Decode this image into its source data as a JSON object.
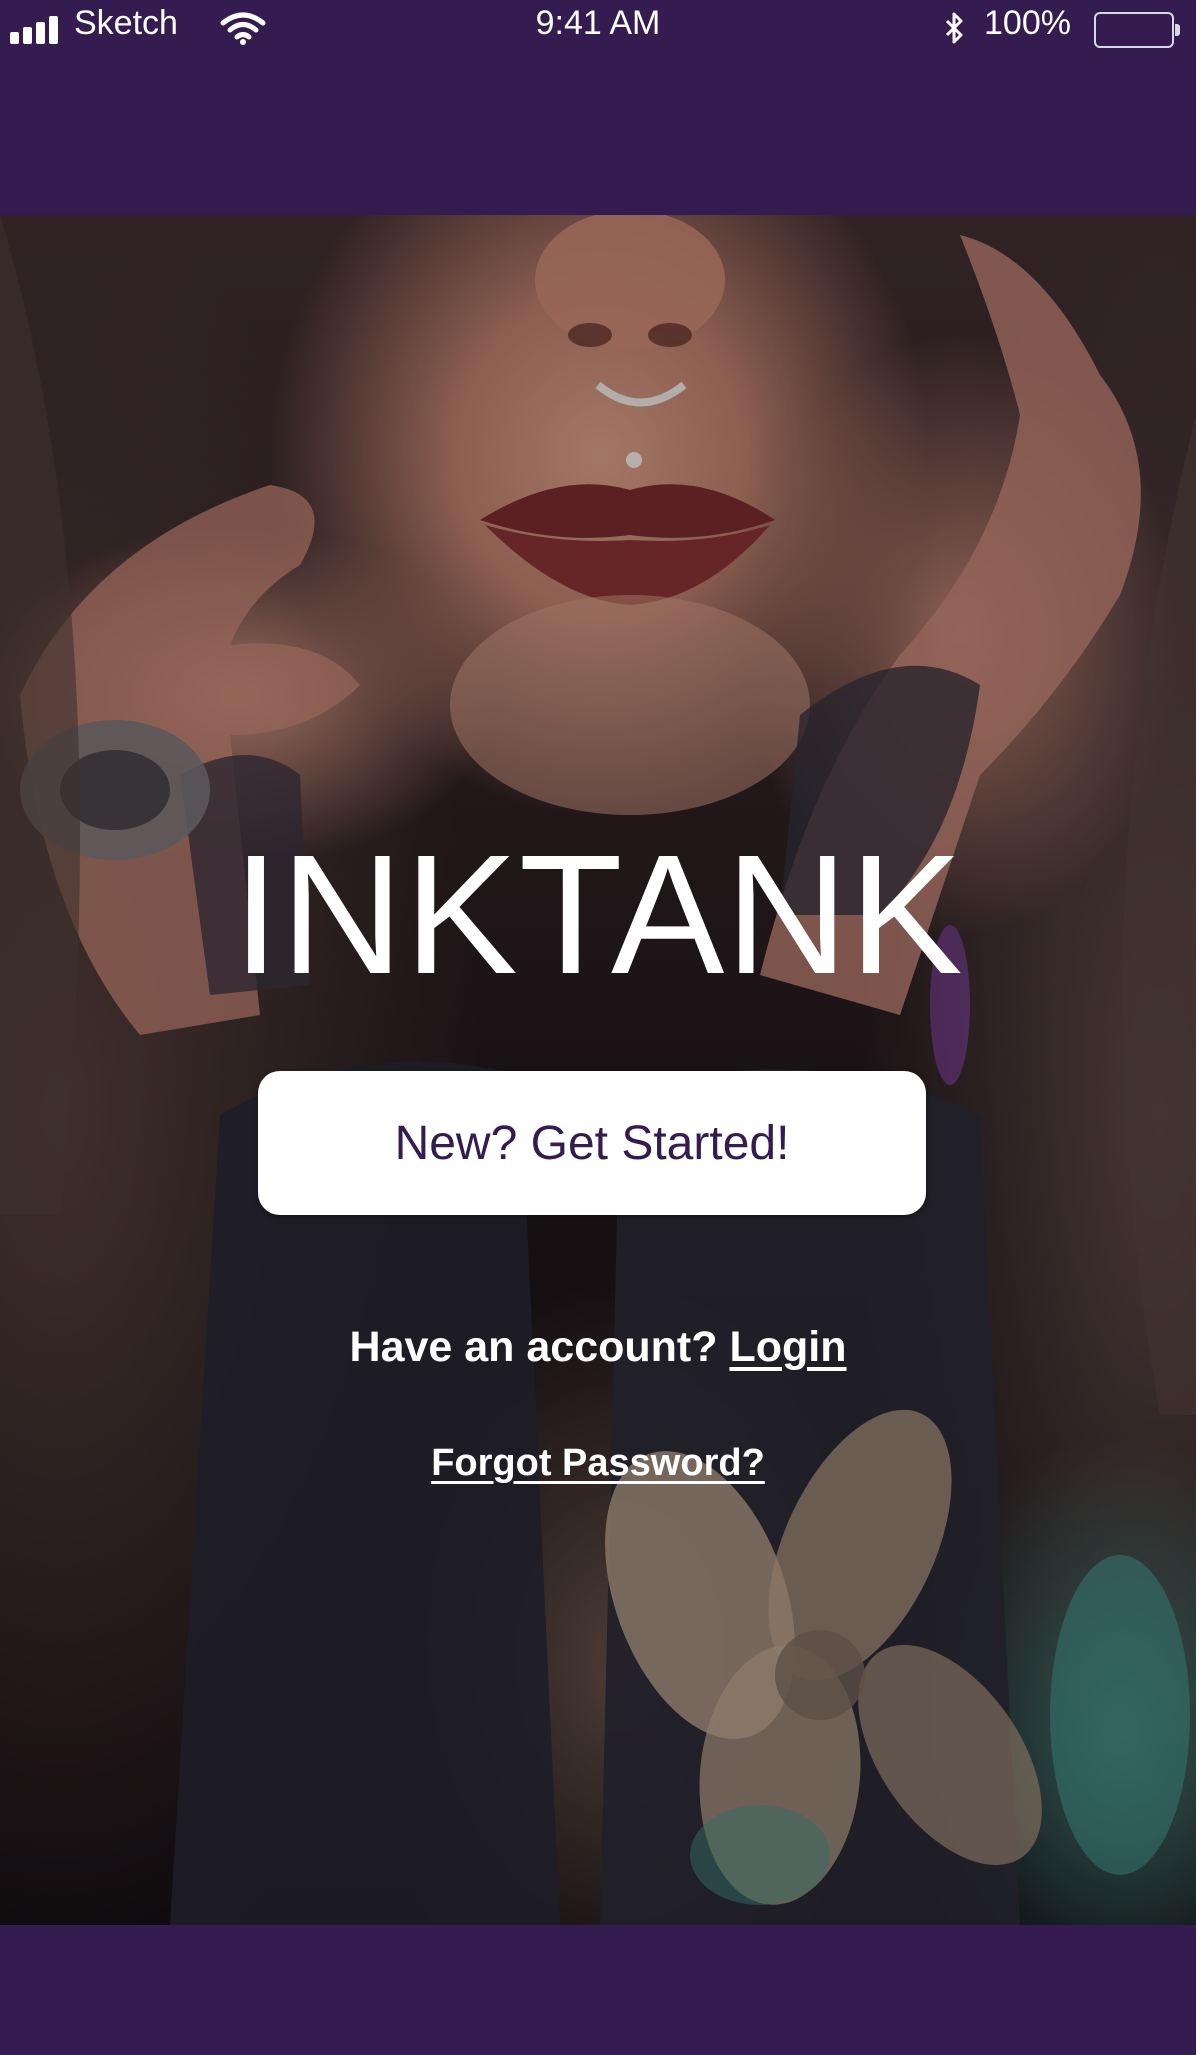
{
  "status_bar": {
    "carrier": "Sketch",
    "time": "9:41 AM",
    "battery_percent": "100%",
    "icons": [
      "signal-icon",
      "wifi-icon",
      "bluetooth-icon",
      "battery-icon"
    ]
  },
  "hero": {
    "app_title": "INKTANK",
    "cta_label": "New? Get Started!",
    "account_prompt": "Have an account?",
    "login_label": "Login",
    "forgot_label": "Forgot Password?"
  },
  "colors": {
    "brand_purple": "#351c50",
    "text_white": "#ffffff",
    "button_bg": "#ffffff"
  }
}
